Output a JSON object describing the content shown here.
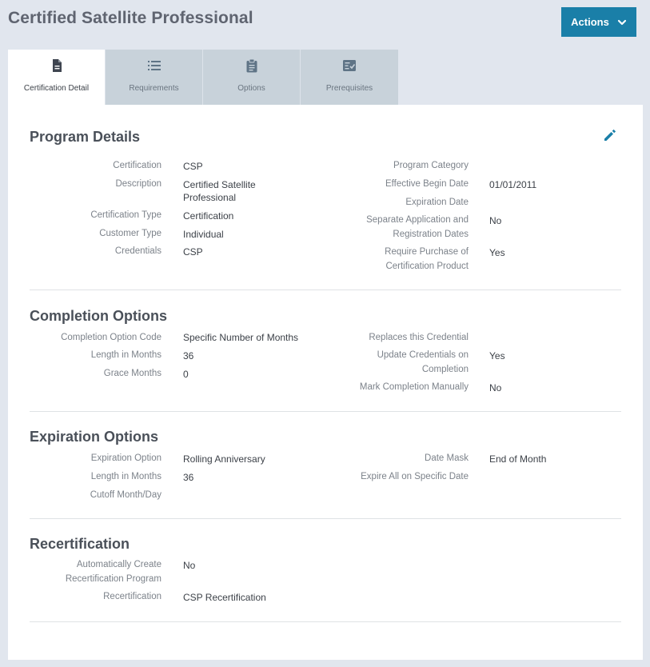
{
  "page": {
    "title": "Certified Satellite Professional"
  },
  "actions": {
    "label": "Actions"
  },
  "tabs": [
    {
      "label": "Certification Detail",
      "icon": "document-icon",
      "active": true
    },
    {
      "label": "Requirements",
      "icon": "list-icon",
      "active": false
    },
    {
      "label": "Options",
      "icon": "clipboard-icon",
      "active": false
    },
    {
      "label": "Prerequisites",
      "icon": "checklist-icon",
      "active": false
    }
  ],
  "program_details": {
    "title": "Program Details",
    "certification_label": "Certification",
    "certification": "CSP",
    "description_label": "Description",
    "description_line1": "Certified Satellite",
    "description_line2": "Professional",
    "certification_type_label": "Certification Type",
    "certification_type": "Certification",
    "customer_type_label": "Customer Type",
    "customer_type": "Individual",
    "credentials_label": "Credentials",
    "credentials": "CSP",
    "program_category_label": "Program Category",
    "program_category": "",
    "effective_begin_label": "Effective Begin Date",
    "effective_begin": "01/01/2011",
    "expiration_date_label": "Expiration Date",
    "expiration_date": "",
    "separate_app_label1": "Separate Application and",
    "separate_app_label2": "Registration Dates",
    "separate_app": "No",
    "require_purchase_label1": "Require Purchase of",
    "require_purchase_label2": "Certification Product",
    "require_purchase": "Yes"
  },
  "completion_options": {
    "title": "Completion Options",
    "code_label": "Completion Option Code",
    "code": "Specific Number of Months",
    "length_label": "Length in Months",
    "length": "36",
    "grace_label": "Grace Months",
    "grace": "0",
    "replaces_label": "Replaces this Credential",
    "replaces": "",
    "update_label1": "Update Credentials on",
    "update_label2": "Completion",
    "update": "Yes",
    "manual_label": "Mark Completion Manually",
    "manual": "No"
  },
  "expiration_options": {
    "title": "Expiration Options",
    "option_label": "Expiration Option",
    "option": "Rolling Anniversary",
    "length_label": "Length in Months",
    "length": "36",
    "cutoff_label": "Cutoff Month/Day",
    "cutoff": "",
    "mask_label": "Date Mask",
    "mask": "End of Month",
    "expire_all_label": "Expire All on Specific Date",
    "expire_all": ""
  },
  "recertification": {
    "title": "Recertification",
    "auto_label1": "Automatically Create",
    "auto_label2": "Recertification Program",
    "auto": "No",
    "recert_label": "Recertification",
    "recert": "CSP Recertification"
  },
  "colors": {
    "accent": "#1a7fa8",
    "background": "#e1e6ee",
    "tab_inactive": "#c8d2da"
  }
}
